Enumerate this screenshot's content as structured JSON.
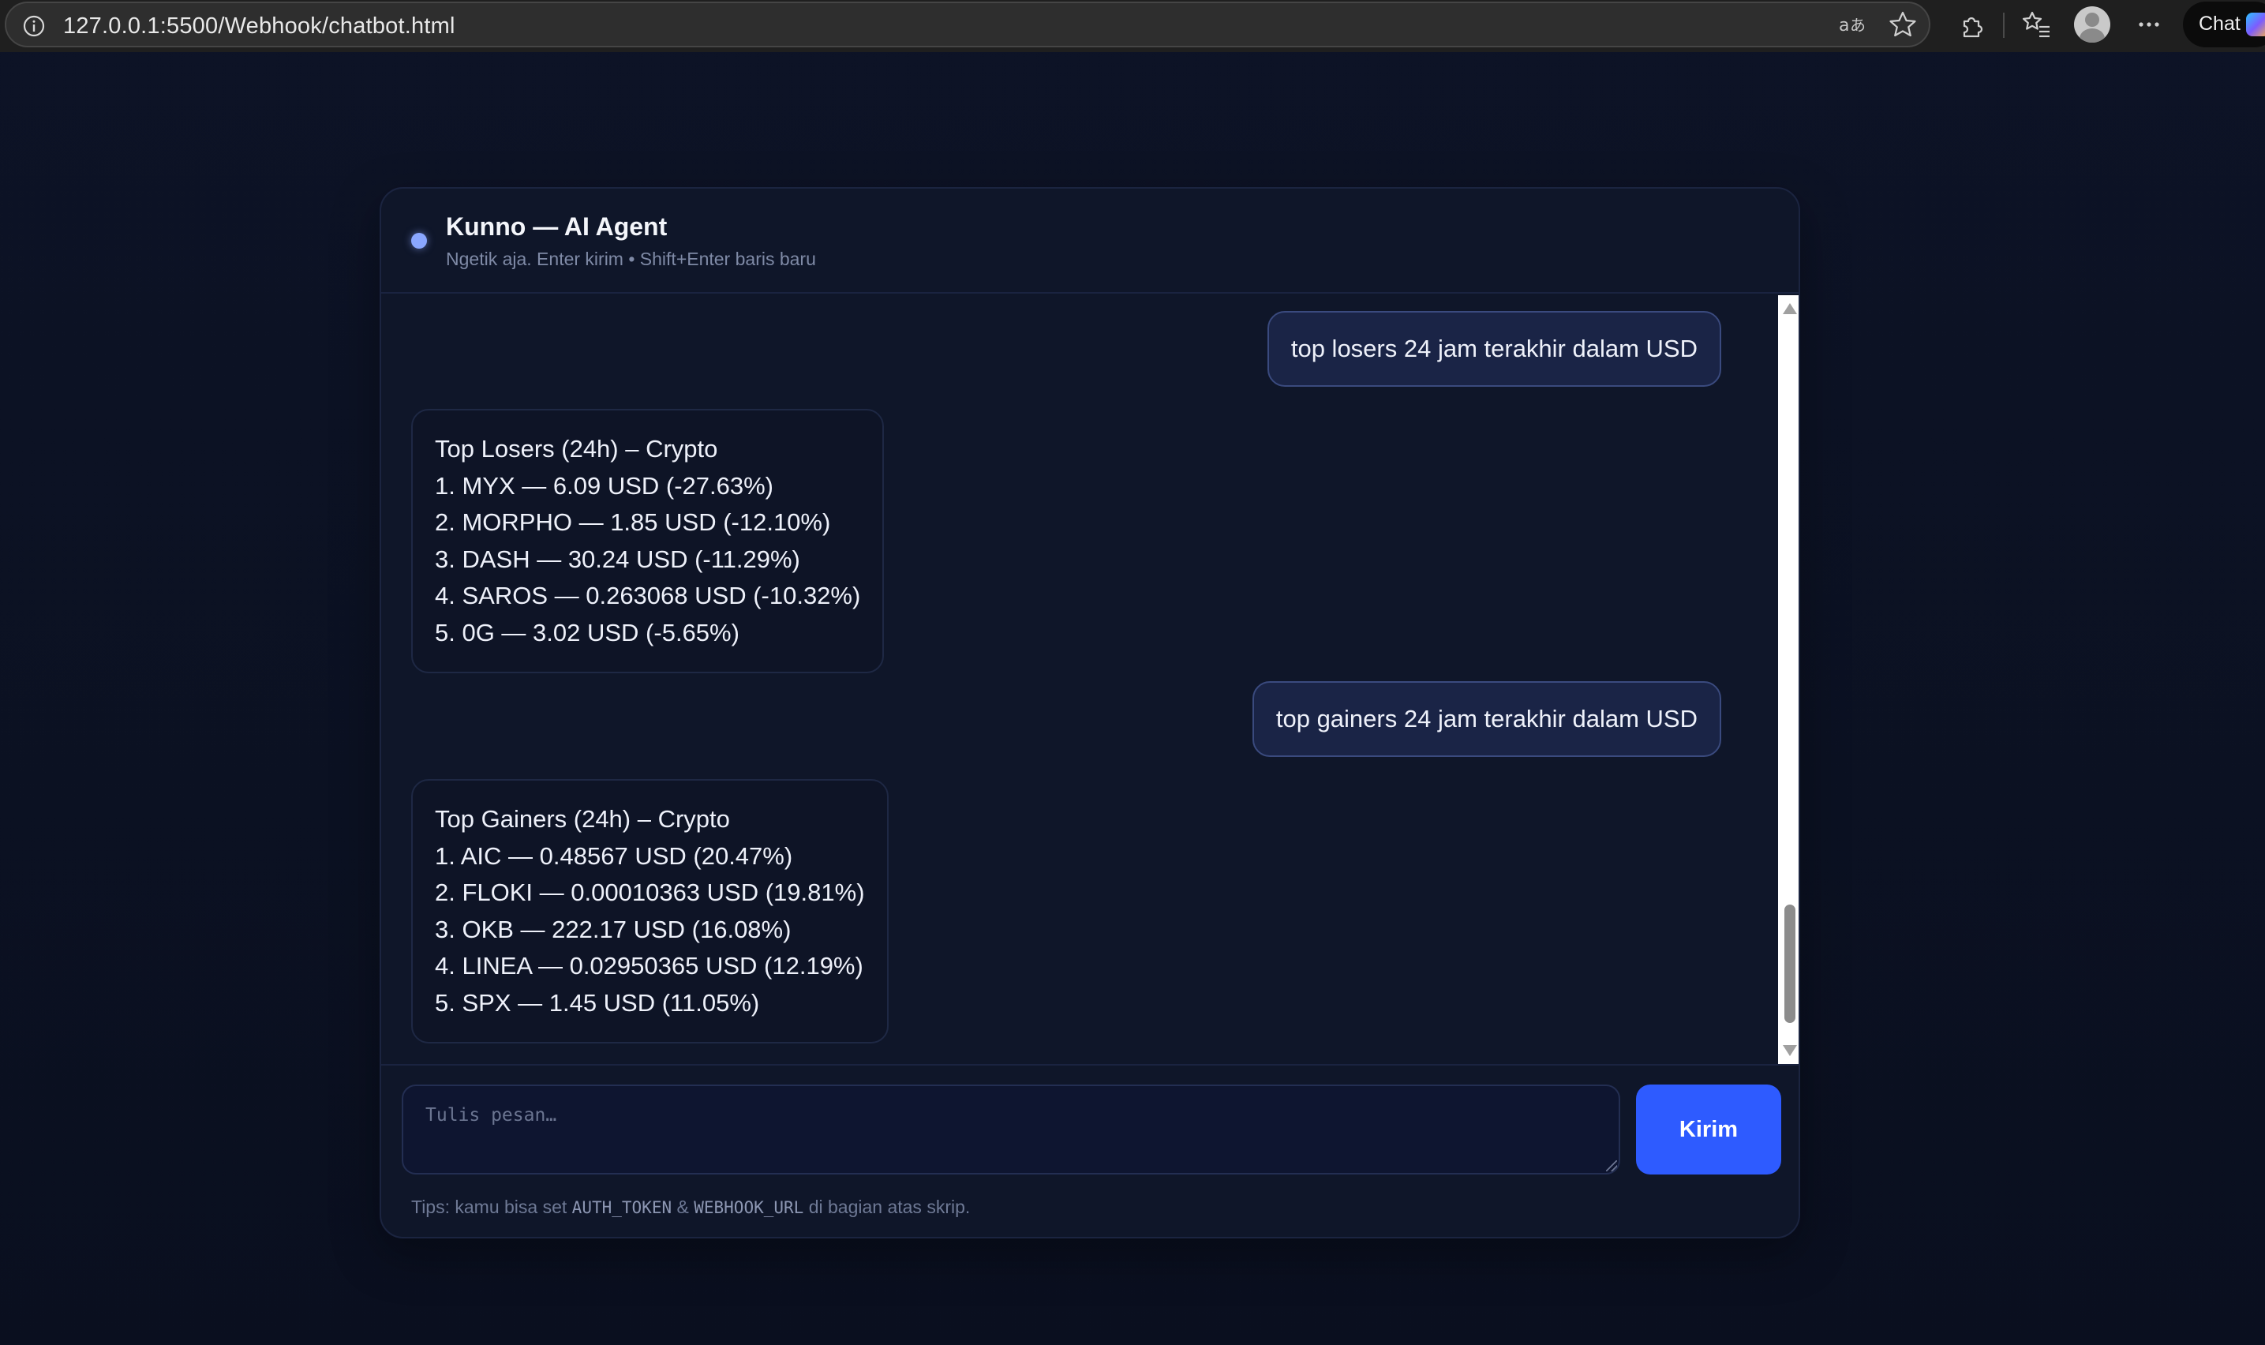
{
  "browser": {
    "url": "127.0.0.1:5500/Webhook/chatbot.html",
    "chat_button_label": "Chat",
    "toolbar_icons": [
      "info-icon",
      "read-aloud-icon",
      "favorite-star-icon",
      "extensions-icon",
      "favorites-icon",
      "profile-avatar",
      "more-options-icon",
      "copilot-icon"
    ]
  },
  "header": {
    "title": "Kunno — AI Agent",
    "subtitle": "Ngetik aja. Enter kirim • Shift+Enter baris baru",
    "status_color": "#8aa7ff"
  },
  "messages": [
    {
      "role": "user",
      "text": "top losers 24 jam terakhir dalam USD"
    },
    {
      "role": "bot",
      "lines": [
        "Top Losers (24h) – Crypto",
        "1. MYX — 6.09 USD (-27.63%)",
        "2. MORPHO — 1.85 USD (-12.10%)",
        "3. DASH — 30.24 USD (-11.29%)",
        "4. SAROS — 0.263068 USD (-10.32%)",
        "5. 0G — 3.02 USD (-5.65%)"
      ]
    },
    {
      "role": "user",
      "text": "top gainers 24 jam terakhir dalam USD"
    },
    {
      "role": "bot",
      "lines": [
        "Top Gainers (24h) – Crypto",
        "1. AIC — 0.48567 USD (20.47%)",
        "2. FLOKI — 0.00010363 USD (19.81%)",
        "3. OKB — 222.17 USD (16.08%)",
        "4. LINEA — 0.02950365 USD (12.19%)",
        "5. SPX — 1.45 USD (11.05%)"
      ]
    }
  ],
  "composer": {
    "placeholder": "Tulis pesan…",
    "value": "",
    "send_label": "Kirim",
    "send_color": "#2e5bff"
  },
  "tips": {
    "prefix": "Tips: kamu bisa set ",
    "code1": "AUTH_TOKEN",
    "joiner": " & ",
    "code2": "WEBHOOK_URL",
    "suffix": " di bagian atas skrip."
  }
}
